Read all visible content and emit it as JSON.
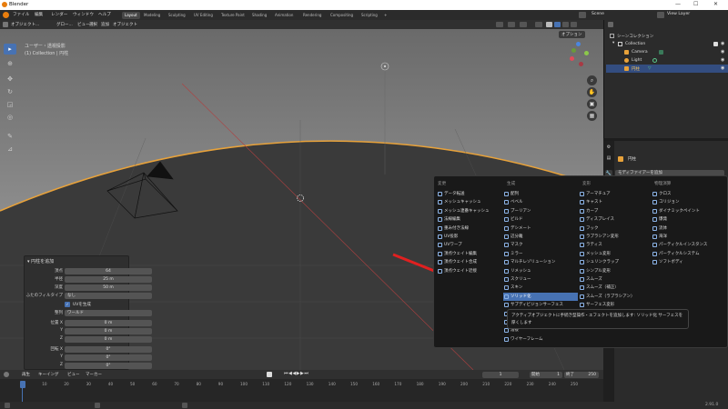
{
  "titlebar": {
    "title": "Blender",
    "min": "—",
    "max": "☐",
    "close": "✕"
  },
  "menubar": {
    "items": [
      "ファイル",
      "編集",
      "レンダー",
      "ウィンドウ",
      "ヘルプ"
    ],
    "workspaces": [
      "Layout",
      "Modeling",
      "Sculpting",
      "UV Editing",
      "Texture Paint",
      "Shading",
      "Animation",
      "Rendering",
      "Compositing",
      "Scripting",
      "+"
    ],
    "scene": "Scene",
    "view_layer": "View Layer"
  },
  "viewport_header": {
    "items": [
      "オブジェクト...",
      "グロー...",
      "ビュー",
      "選択",
      "追加",
      "オブジェクト"
    ],
    "options": "オプション"
  },
  "viewport": {
    "info_line1": "ユーザー・透視投影",
    "info_line2": "(1) Collection | 円柱",
    "gizmo": {
      "x_color": "#e04a5a",
      "y_color": "#8cc84a",
      "z_color": "#4a86e0"
    }
  },
  "operator_panel": {
    "title": "円柱を追加",
    "rows": [
      {
        "label": "頂点",
        "value": "64"
      },
      {
        "label": "半径",
        "value": "25 m"
      },
      {
        "label": "深度",
        "value": "50 m"
      },
      {
        "label": "ふたのフィルタイプ",
        "value": "なし"
      },
      {
        "label": "",
        "value": "UVを生成",
        "checkbox": true
      },
      {
        "label": "整列",
        "value": "ワールド"
      },
      {
        "label": "位置 X",
        "value": "0 m"
      },
      {
        "label": "Y",
        "value": "0 m"
      },
      {
        "label": "Z",
        "value": "0 m"
      },
      {
        "label": "回転 X",
        "value": "0°"
      },
      {
        "label": "Y",
        "value": "0°"
      },
      {
        "label": "Z",
        "value": "0°"
      }
    ]
  },
  "timeline": {
    "menu": [
      "再生",
      "キーイング",
      "ビュー",
      "マーカー"
    ],
    "current_frame": "1",
    "start_label": "開始",
    "start": "1",
    "end_label": "終了",
    "end": "250",
    "ticks": [
      "1",
      "10",
      "20",
      "30",
      "40",
      "50",
      "60",
      "70",
      "80",
      "90",
      "100",
      "110",
      "120",
      "130",
      "140",
      "150",
      "160",
      "170",
      "180",
      "190",
      "200",
      "210",
      "220",
      "230",
      "240",
      "250"
    ]
  },
  "outliner": {
    "header": "シーンコレクション",
    "items": [
      {
        "label": "Collection",
        "indent": 0
      },
      {
        "label": "Camera",
        "indent": 1
      },
      {
        "label": "Light",
        "indent": 1
      },
      {
        "label": "円柱",
        "indent": 1,
        "selected": true
      }
    ]
  },
  "properties": {
    "object_name": "円柱",
    "add_modifier": "モディファイアーを追加"
  },
  "modifier_menu": {
    "columns": [
      {
        "title": "変更",
        "items": [
          "データ転送",
          "メッシュキャッシュ",
          "メッシュ連番キャッシュ",
          "法線編集",
          "重み付き法線",
          "UV投影",
          "UVワープ",
          "頂点ウェイト編集",
          "頂点ウェイト合成",
          "頂点ウェイト近接"
        ]
      },
      {
        "title": "生成",
        "items": [
          "配列",
          "ベベル",
          "ブーリアン",
          "ビルド",
          "デシメート",
          "辺分離",
          "マスク",
          "ミラー",
          "マルチレゾリューション",
          "リメッシュ",
          "スクリュー",
          "スキン",
          "ソリッド化",
          "サブディビジョンサーフェス",
          "三角面化",
          "ボリューム",
          "溶接",
          "ワイヤーフレーム"
        ]
      },
      {
        "title": "変形",
        "items": [
          "アーマチュア",
          "キャスト",
          "カーブ",
          "ディスプレイス",
          "フック",
          "ラプラシアン変形",
          "ラティス",
          "メッシュ変形",
          "シュリンクラップ",
          "シンプル変形",
          "スムーズ",
          "スムーズ（補正）",
          "スムーズ（ラプラシアン）",
          "サーフェス変形",
          "ワープ",
          "波紋"
        ]
      },
      {
        "title": "物理演算",
        "items": [
          "クロス",
          "コリジョン",
          "ダイナミックペイント",
          "爆発",
          "流体",
          "海洋",
          "パーティクルインスタンス",
          "パーティクルシステム",
          "ソフトボディ"
        ]
      }
    ],
    "highlighted": "ソリッド化",
    "tooltip": "アクティブオブジェクトに手続き型操作・エフェクトを追加します: ソリッド化 サーフェスを厚くします"
  },
  "statusbar": {
    "version": "2.91.0"
  },
  "colors": {
    "accent": "#4772b3",
    "selection_orange": "#e8a23a",
    "arrow": "#e02020"
  }
}
